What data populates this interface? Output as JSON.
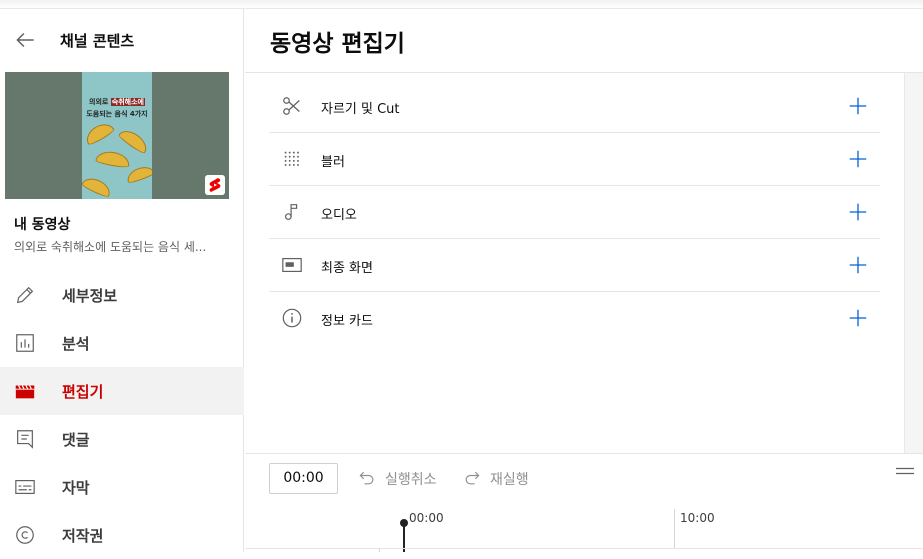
{
  "sidebar": {
    "title": "채널 콘텐츠",
    "thumbnail": {
      "overlay_line1_prefix": "의외로",
      "overlay_line1_highlight": "숙취해소에",
      "overlay_line2": "도움되는 음식 4가지"
    },
    "video_heading": "내 동영상",
    "video_description": "의외로 숙취해소에 도움되는 음식 세...",
    "items": [
      {
        "label": "세부정보",
        "icon": "pencil-icon"
      },
      {
        "label": "분석",
        "icon": "analytics-icon"
      },
      {
        "label": "편집기",
        "icon": "clapperboard-icon",
        "active": true
      },
      {
        "label": "댓글",
        "icon": "comment-icon"
      },
      {
        "label": "자막",
        "icon": "subtitles-icon"
      },
      {
        "label": "저작권",
        "icon": "copyright-icon"
      }
    ]
  },
  "main": {
    "title": "동영상 편집기",
    "tools": [
      {
        "label": "자르기 및 Cut",
        "icon": "scissors-icon"
      },
      {
        "label": "블러",
        "icon": "blur-icon"
      },
      {
        "label": "오디오",
        "icon": "music-note-icon"
      },
      {
        "label": "최종 화면",
        "icon": "end-screen-icon"
      },
      {
        "label": "정보 카드",
        "icon": "info-icon"
      }
    ]
  },
  "timeline": {
    "current_time": "00:00",
    "undo_label": "실행취소",
    "redo_label": "재실행",
    "ruler": [
      "00:00",
      "10:00"
    ]
  },
  "colors": {
    "accent_red": "#cc0000",
    "add_icon_blue": "#065fd4",
    "active_bg": "#f2f2f2"
  }
}
